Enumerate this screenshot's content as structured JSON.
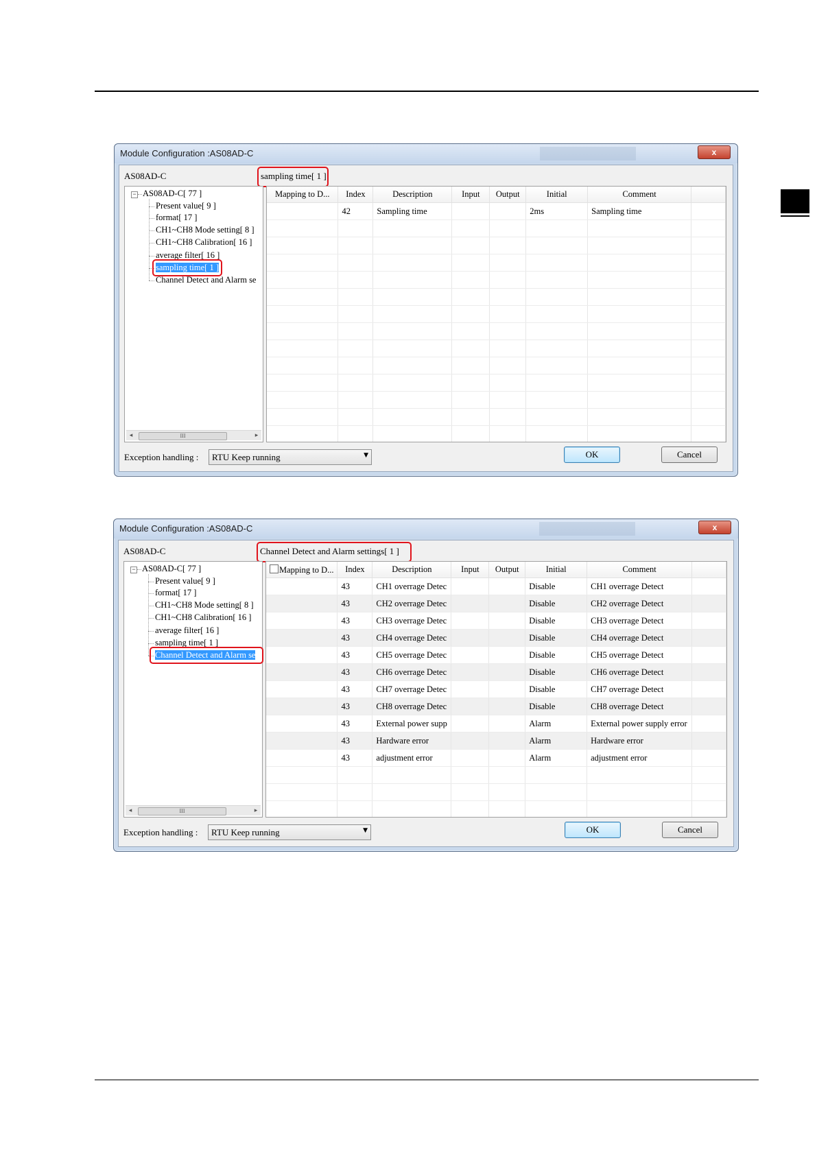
{
  "dialogs": [
    {
      "window_title": "Module Configuration :AS08AD-C",
      "close_label": "x",
      "module_name": "AS08AD-C",
      "section_label": "sampling time[ 1 ]",
      "tree_root": "AS08AD-C[ 77 ]",
      "tree_items": [
        "Present value[ 9 ]",
        "format[ 17 ]",
        "CH1~CH8 Mode setting[ 8 ]",
        "CH1~CH8 Calibration[ 16 ]",
        "average filter[ 16 ]",
        "sampling time[ 1 ]",
        "Channel Detect and Alarm se"
      ],
      "selected_item": "sampling time[ 1 ]",
      "scroll_thumb": "III",
      "columns": [
        "Mapping to D...",
        "Index",
        "Description",
        "Input",
        "Output",
        "Initial",
        "Comment"
      ],
      "rows": [
        [
          "",
          "42",
          "Sampling time",
          "",
          "",
          "2ms",
          "Sampling time"
        ]
      ],
      "exception_label": "Exception handling :",
      "exception_value": "RTU Keep running",
      "ok_label": "OK",
      "cancel_label": "Cancel"
    },
    {
      "window_title": "Module Configuration :AS08AD-C",
      "close_label": "x",
      "module_name": "AS08AD-C",
      "section_label": "Channel Detect and Alarm settings[ 1 ]",
      "tree_root": "AS08AD-C[ 77 ]",
      "tree_items": [
        "Present value[ 9 ]",
        "format[ 17 ]",
        "CH1~CH8 Mode setting[ 8 ]",
        "CH1~CH8 Calibration[ 16 ]",
        "average filter[ 16 ]",
        "sampling time[ 1 ]",
        "Channel Detect and Alarm se"
      ],
      "selected_item": "Channel Detect and Alarm se",
      "scroll_thumb": "III",
      "columns": [
        "Mapping to D...",
        "Index",
        "Description",
        "Input",
        "Output",
        "Initial",
        "Comment"
      ],
      "rows": [
        [
          "",
          "43",
          "CH1 overrage Detec",
          "",
          "",
          "Disable",
          "CH1 overrage Detect"
        ],
        [
          "",
          "43",
          "CH2 overrage Detec",
          "",
          "",
          "Disable",
          "CH2 overrage Detect"
        ],
        [
          "",
          "43",
          "CH3 overrage Detec",
          "",
          "",
          "Disable",
          "CH3 overrage Detect"
        ],
        [
          "",
          "43",
          "CH4 overrage Detec",
          "",
          "",
          "Disable",
          "CH4 overrage Detect"
        ],
        [
          "",
          "43",
          "CH5 overrage Detec",
          "",
          "",
          "Disable",
          "CH5 overrage Detect"
        ],
        [
          "",
          "43",
          "CH6 overrage Detec",
          "",
          "",
          "Disable",
          "CH6 overrage Detect"
        ],
        [
          "",
          "43",
          "CH7 overrage Detec",
          "",
          "",
          "Disable",
          "CH7 overrage Detect"
        ],
        [
          "",
          "43",
          "CH8 overrage Detec",
          "",
          "",
          "Disable",
          "CH8 overrage Detect"
        ],
        [
          "",
          "43",
          "External power supp",
          "",
          "",
          "Alarm",
          "External power supply error"
        ],
        [
          "",
          "43",
          "Hardware error",
          "",
          "",
          "Alarm",
          "Hardware error"
        ],
        [
          "",
          "43",
          "adjustment error",
          "",
          "",
          "Alarm",
          "adjustment error"
        ]
      ],
      "exception_label": "Exception handling :",
      "exception_value": "RTU Keep running",
      "ok_label": "OK",
      "cancel_label": "Cancel"
    }
  ],
  "colors": {
    "highlight": "#e0141c",
    "selection": "#3399ff"
  },
  "icons": {
    "dropdown": "chevron-down-icon",
    "close": "close-icon",
    "expander": "tree-collapse-icon"
  }
}
